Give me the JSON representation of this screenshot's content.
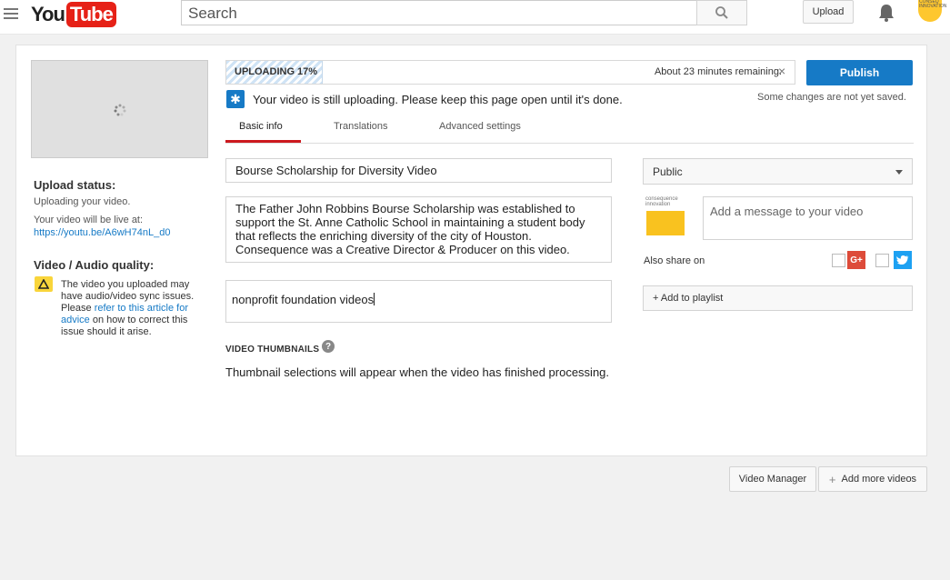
{
  "header": {
    "logo_you": "You",
    "logo_tube": "Tube",
    "search_placeholder": "Search",
    "upload_label": "Upload",
    "avatar_text": "CONSEQ INNOVATION"
  },
  "left": {
    "upload_status_title": "Upload status:",
    "upload_status_text": "Uploading your video.",
    "live_text": "Your video will be live at:",
    "live_link": "https://youtu.be/A6wH74nL_d0",
    "quality_title": "Video / Audio quality:",
    "warning_pre": "The video you uploaded may have audio/video sync issues. Please ",
    "warning_link": "refer to this article for advice",
    "warning_post": " on how to correct this issue should it arise."
  },
  "progress": {
    "label": "UPLOADING 17%",
    "percent": 17,
    "remaining": "About 23 minutes remaining.",
    "close": "×"
  },
  "publish_label": "Publish",
  "unsaved_text": "Some changes are not yet saved.",
  "info_text": "Your video is still uploading. Please keep this page open until it's done.",
  "tabs": [
    {
      "label": "Basic info",
      "active": true
    },
    {
      "label": "Translations",
      "active": false
    },
    {
      "label": "Advanced settings",
      "active": false
    }
  ],
  "fields": {
    "title": "Bourse Scholarship for Diversity Video",
    "description": "The Father John Robbins Bourse Scholarship was established to support the St. Anne Catholic School in maintaining a student body that reflects the enriching diversity of the city of Houston. Consequence was a Creative Director & Producer on this video.",
    "tags": "nonprofit foundation videos"
  },
  "thumbnails": {
    "title": "VIDEO THUMBNAILS",
    "help": "?",
    "text": "Thumbnail selections will appear when the video has finished processing."
  },
  "right": {
    "privacy": "Public",
    "channel_logo_text": "consequence innovation",
    "message_placeholder": "Add a message to your video",
    "also_share": "Also share on",
    "gplus": "G+",
    "playlist": "+ Add to playlist"
  },
  "bottom": {
    "video_manager": "Video Manager",
    "add_more": "Add more videos"
  },
  "colors": {
    "brand_red": "#e62117",
    "accent_blue": "#167ac6",
    "tab_underline": "#cc181e",
    "warning_yellow": "#f9d53b"
  }
}
